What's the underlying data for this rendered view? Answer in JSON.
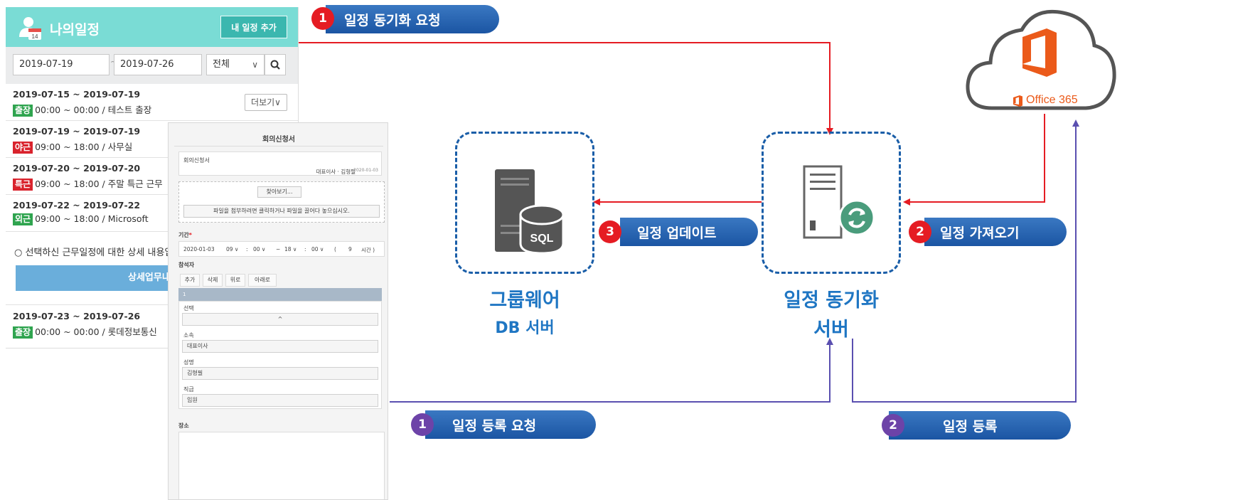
{
  "schedule_panel": {
    "title": "나의일정",
    "calendar_day": "14",
    "add_button": "내 일정 추가",
    "filter": {
      "start_date": "2019-07-19",
      "separator": "~",
      "end_date": "2019-07-26",
      "category": "전체",
      "category_chevron": "∨"
    },
    "more_button": "더보기∨",
    "items": [
      {
        "range": "2019-07-15 ~ 2019-07-19",
        "badge": "출장",
        "badge_color": "#2fa44f",
        "time": "00:00 ~ 00:00 / 테스트 출장"
      },
      {
        "range": "2019-07-19 ~ 2019-07-19",
        "badge": "야근",
        "badge_color": "#d9232d",
        "time": "09:00 ~ 18:00 / 사무실"
      },
      {
        "range": "2019-07-20 ~ 2019-07-20",
        "badge": "특근",
        "badge_color": "#d9232d",
        "time": "09:00 ~ 18:00 / 주말 특근 근무"
      },
      {
        "range": "2019-07-22 ~ 2019-07-22",
        "badge": "외근",
        "badge_color": "#2fa44f",
        "time": "09:00 ~ 18:00 / Microsoft"
      },
      {
        "range": "2019-07-23 ~ 2019-07-26",
        "badge": "출장",
        "badge_color": "#2fa44f",
        "time": "00:00 ~ 00:00 / 롯데정보통신"
      }
    ],
    "note": "○ 선택하신 근무일정에 대한 상세 내용입니",
    "detail_button": "상세업무내용"
  },
  "meeting_form": {
    "title": "회의신청서",
    "doc_name": "회의신청서",
    "author": "대표이사 · 김형필",
    "author_date": "2020-01-03",
    "browse_button": "찾아보기...",
    "attach_hint": "파일을 첨부하려면 클릭하거나 파일을 끌어다 놓으십시오.",
    "period_label": "기간",
    "required_mark": "*",
    "period": {
      "date": "2020-01-03",
      "start_hour": "09 ∨",
      "colon": ":",
      "start_min": "00 ∨",
      "tilde": "~",
      "end_hour": "18 ∨",
      "end_min": "00 ∨",
      "paren_open": "(",
      "duration": "9",
      "unit": "시간 )"
    },
    "attendee_label": "참석자",
    "attendee_buttons": [
      "추가",
      "삭제",
      "위로",
      "아래로"
    ],
    "row_index": "1",
    "fields": [
      {
        "label": "선택",
        "value": "^"
      },
      {
        "label": "소속",
        "value": "대표이사"
      },
      {
        "label": "성명",
        "value": "김형필"
      },
      {
        "label": "직급",
        "value": "임원"
      }
    ],
    "place_label": "장소"
  },
  "diagram": {
    "steps": {
      "sync_request": {
        "num": "1",
        "label": "일정 동기화 요청"
      },
      "fetch_schedule": {
        "num": "2",
        "label": "일정 가져오기"
      },
      "update_schedule": {
        "num": "3",
        "label": "일정 업데이트"
      },
      "register_request": {
        "num": "1",
        "label": "일정 등록 요청"
      },
      "register": {
        "num": "2",
        "label": "일정 등록"
      }
    },
    "groupware_db": {
      "line1": "그룹웨어",
      "line2": "DB 서버"
    },
    "sync_server": {
      "line1": "일정 동기화",
      "line2": "서버"
    },
    "office365_label": "Office 365",
    "sql_label": "SQL",
    "colors": {
      "red_flow": "#e51c23",
      "purple_flow": "#5a4fb0",
      "pill_blue": "#1b55a3",
      "server_border": "#1a5ea8",
      "caption": "#1f76c3",
      "office_orange": "#eb5a1a"
    }
  }
}
